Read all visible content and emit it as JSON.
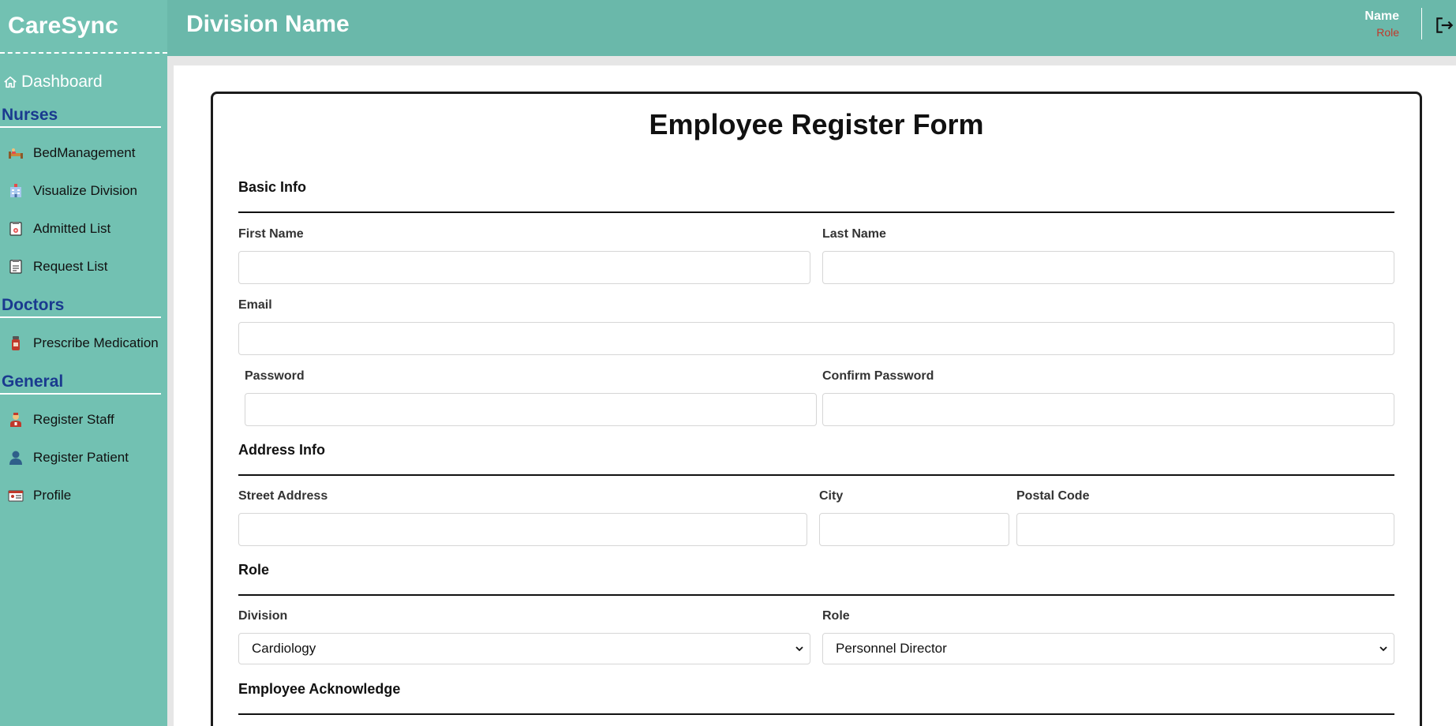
{
  "brand": "CareSync",
  "header": {
    "division": "Division Name",
    "user_name": "Name",
    "user_role": "Role"
  },
  "sidebar": {
    "dashboard": "Dashboard",
    "sections": [
      {
        "title": "Nurses",
        "items": [
          {
            "label": "BedManagement",
            "icon": "bed-icon"
          },
          {
            "label": "Visualize Division",
            "icon": "hospital-icon"
          },
          {
            "label": "Admitted List",
            "icon": "admitted-list-icon"
          },
          {
            "label": "Request List",
            "icon": "request-list-icon"
          }
        ]
      },
      {
        "title": "Doctors",
        "items": [
          {
            "label": "Prescribe Medication",
            "icon": "medication-icon"
          }
        ]
      },
      {
        "title": "General",
        "items": [
          {
            "label": "Register Staff",
            "icon": "staff-icon"
          },
          {
            "label": "Register Patient",
            "icon": "patient-icon"
          },
          {
            "label": "Profile",
            "icon": "profile-card-icon"
          }
        ]
      }
    ]
  },
  "form": {
    "title": "Employee Register Form",
    "basic_info": "Basic Info",
    "first_name": {
      "label": "First Name",
      "value": ""
    },
    "last_name": {
      "label": "Last Name",
      "value": ""
    },
    "email": {
      "label": "Email",
      "value": ""
    },
    "password": {
      "label": "Password",
      "value": ""
    },
    "confirm_password": {
      "label": "Confirm Password",
      "value": ""
    },
    "address_info": "Address Info",
    "street": {
      "label": "Street Address",
      "value": ""
    },
    "city": {
      "label": "City",
      "value": ""
    },
    "postal": {
      "label": "Postal Code",
      "value": ""
    },
    "role_section": "Role",
    "division": {
      "label": "Division",
      "selected": "Cardiology"
    },
    "role": {
      "label": "Role",
      "selected": "Personnel Director"
    },
    "acknowledge": "Employee Acknowledge"
  },
  "colors": {
    "sidebar": "#72c1b2",
    "header": "#6ab8aa",
    "section_title": "#1a3a8f",
    "role_text": "#c0392b"
  }
}
